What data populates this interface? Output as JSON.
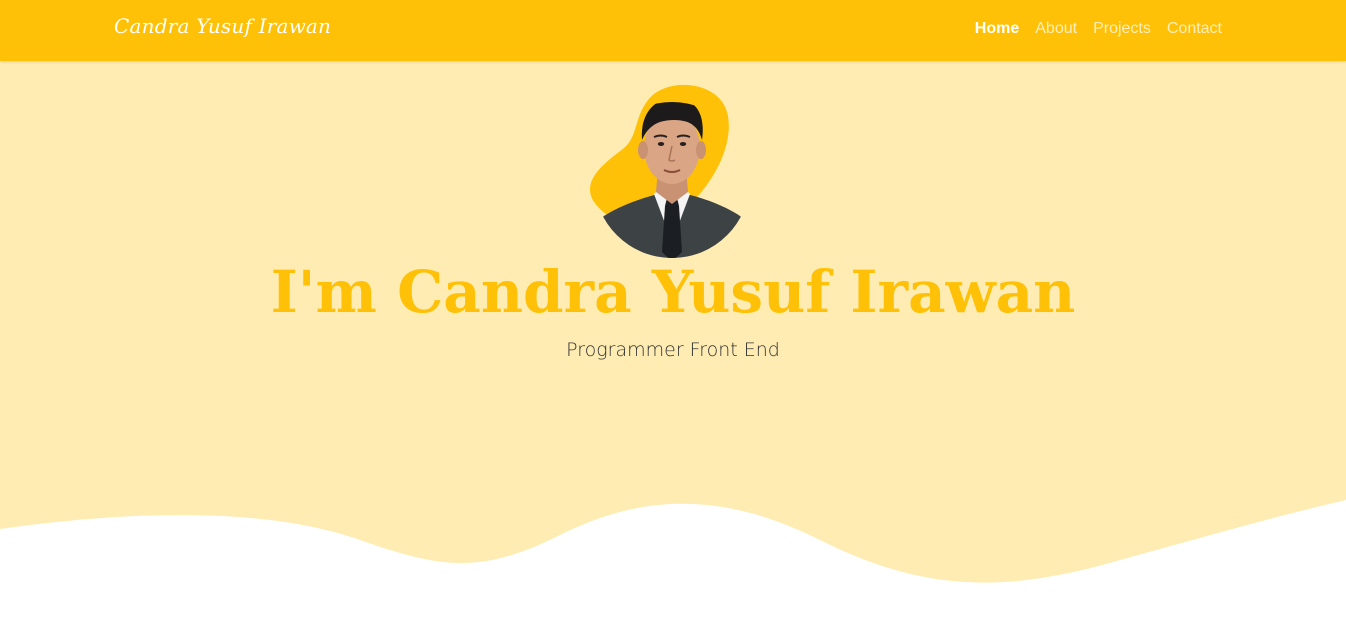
{
  "navbar": {
    "brand": "Candra Yusuf Irawan",
    "items": [
      {
        "label": "Home",
        "active": true
      },
      {
        "label": "About",
        "active": false
      },
      {
        "label": "Projects",
        "active": false
      },
      {
        "label": "Contact",
        "active": false
      }
    ]
  },
  "hero": {
    "title": "I'm Candra Yusuf Irawan",
    "subtitle": "Programmer Front End",
    "avatar": "profile-photo"
  },
  "colors": {
    "primary": "#ffc107",
    "hero_bg": "#ffecb3",
    "wave": "#ffffff",
    "subtitle_text": "#333333"
  }
}
